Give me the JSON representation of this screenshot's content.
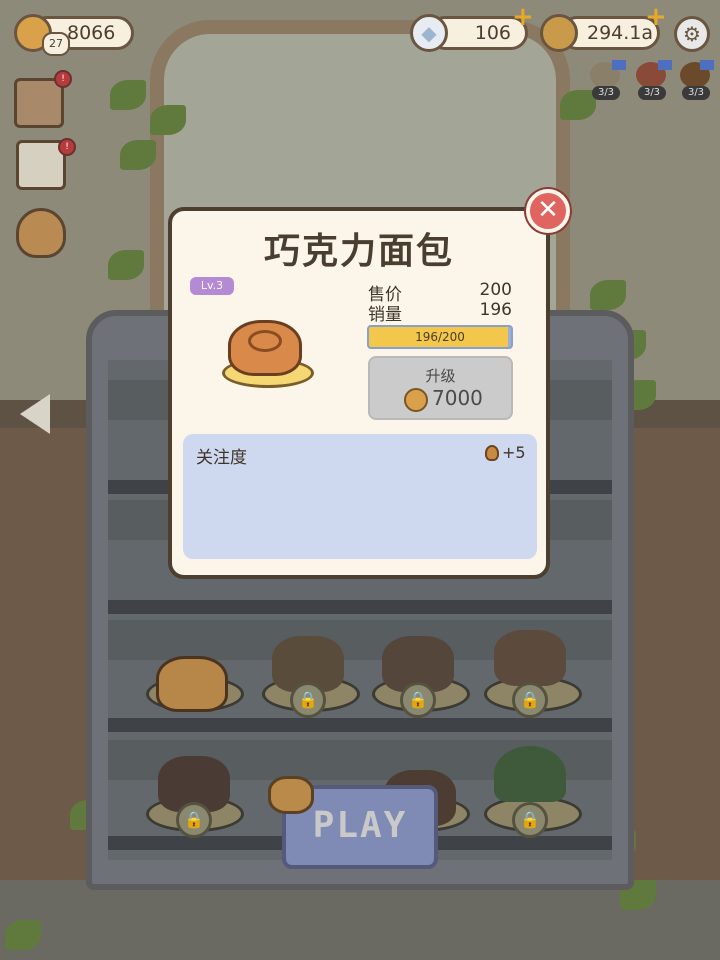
{
  "top_bar": {
    "bread_currency": "8066",
    "level_badge": "27",
    "diamonds": "106",
    "coins": "294.1a",
    "helpers": [
      {
        "icon": "gift-helper-icon",
        "count": "3/3"
      },
      {
        "icon": "flame-helper-icon",
        "count": "3/3"
      },
      {
        "icon": "bread-helper-icon",
        "count": "3/3"
      }
    ]
  },
  "modal": {
    "title": "巧克力面包",
    "level": "Lv.3",
    "price_label": "售价",
    "price_value": "200",
    "sales_label": "销量",
    "sales_value": "196",
    "progress_text": "196/200",
    "progress_fraction": 0.98,
    "upgrade_label": "升级",
    "upgrade_cost": "7000",
    "attention_label": "关注度",
    "attention_value": "+5",
    "close_symbol": "✕"
  },
  "play_button": {
    "label": "PLAY"
  },
  "colors": {
    "progress_fill": "#f3c64c",
    "progress_track": "#9bb0d6",
    "close_button": "#e06460",
    "level_badge": "#b48ad4",
    "attention_panel": "#ced8ef",
    "play_button": "#7f8bb4"
  }
}
